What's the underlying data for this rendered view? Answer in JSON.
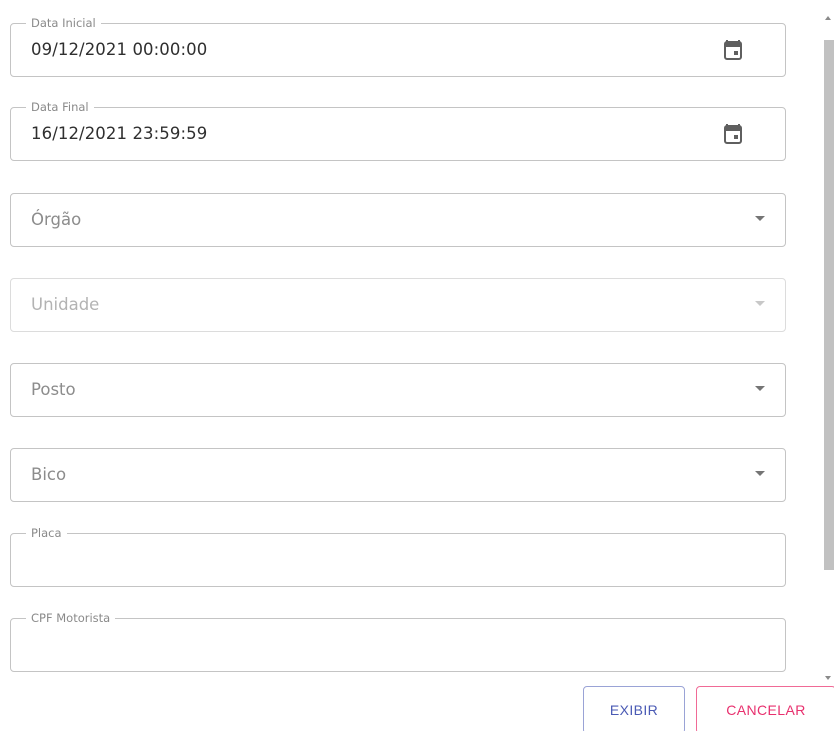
{
  "form": {
    "data_inicial": {
      "label": "Data Inicial",
      "value": "09/12/2021 00:00:00"
    },
    "data_final": {
      "label": "Data Final",
      "value": "16/12/2021 23:59:59"
    },
    "orgao": {
      "placeholder": "Órgão"
    },
    "unidade": {
      "placeholder": "Unidade",
      "disabled": true
    },
    "posto": {
      "placeholder": "Posto"
    },
    "bico": {
      "placeholder": "Bico"
    },
    "placa": {
      "label": "Placa",
      "value": ""
    },
    "cpf_motorista": {
      "label": "CPF Motorista",
      "value": ""
    }
  },
  "actions": {
    "exibir_label": "EXIBIR",
    "cancelar_label": "CANCELAR"
  },
  "icons": {
    "calendar": "calendar-icon",
    "dropdown": "arrow-drop-down-icon"
  },
  "colors": {
    "primary": "#4a5ab4",
    "secondary": "#e8306e",
    "border": "#c4c4c4",
    "scrollbar_thumb": "#c1c1c1"
  }
}
